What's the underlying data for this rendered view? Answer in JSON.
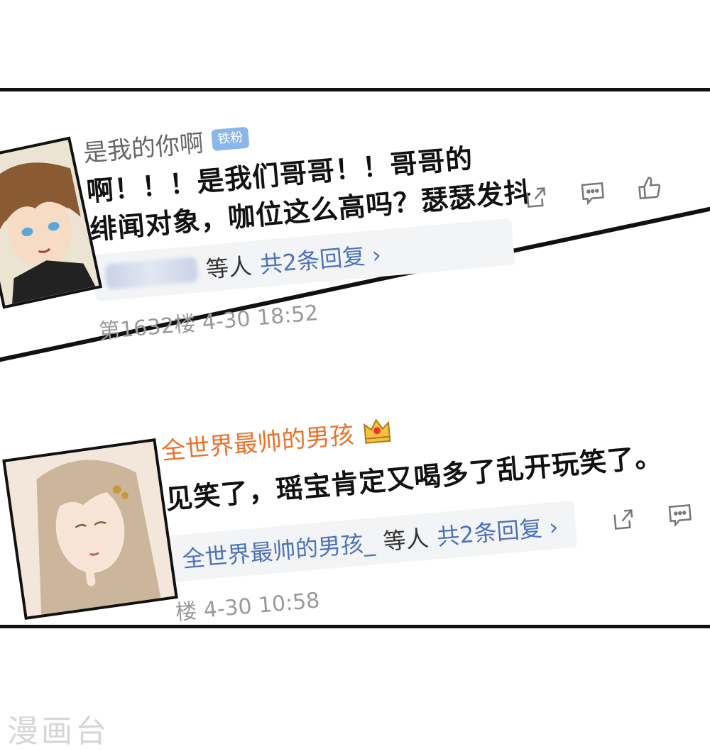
{
  "comments": [
    {
      "username": "是我的你啊",
      "badge": "铁粉",
      "text_line1": "啊！！！是我们哥哥！！哥哥的",
      "text_line2": "绯闻对象，咖位这么高吗？瑟瑟发抖",
      "reply_suffix": "等人",
      "reply_count": "共2条回复 ›",
      "meta": "第1632楼  4-30 18:52",
      "avatar": "brown-hair-boy-avatar"
    },
    {
      "username": "全世界最帅的男孩",
      "text": "见笑了，瑶宝肯定又喝多了乱开玩笑了。",
      "reply_name": "全世界最帅的男孩_",
      "reply_suffix": "等人",
      "reply_count": "共2条回复 ›",
      "meta": "楼  4-30 10:58",
      "avatar": "blonde-girl-avatar"
    }
  ],
  "watermark": "漫画台",
  "colors": {
    "gold_username": "#e9732a",
    "reply_blue": "#4d73b8",
    "badge_blue": "#8ab6e9"
  }
}
